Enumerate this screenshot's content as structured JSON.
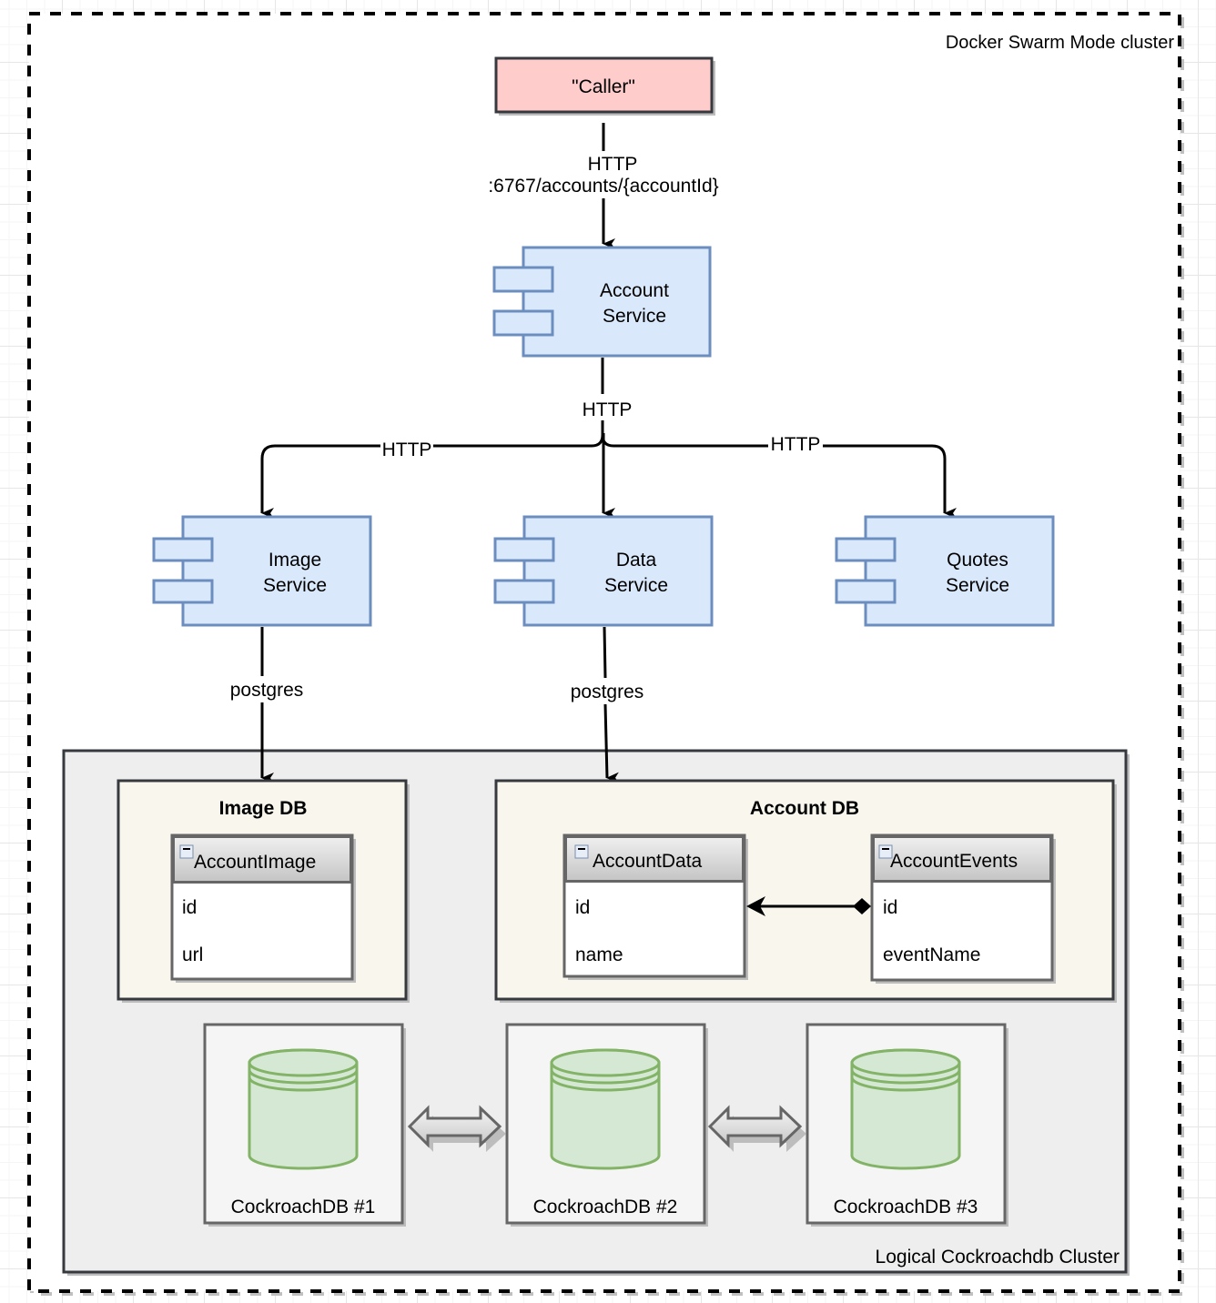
{
  "swarm_cluster": {
    "label": "Docker Swarm Mode cluster"
  },
  "caller": {
    "label": "\"Caller\"",
    "fill": "#ffcccc"
  },
  "edges": {
    "caller_to_account": {
      "line1": "HTTP",
      "line2": ":6767/accounts/{accountId}"
    },
    "account_fanout": "HTTP",
    "to_image": "HTTP",
    "to_quotes": "HTTP",
    "image_to_db": "postgres",
    "data_to_db": "postgres"
  },
  "services": {
    "account": {
      "line1": "Account",
      "line2": "Service"
    },
    "image": {
      "line1": "Image",
      "line2": "Service"
    },
    "data": {
      "line1": "Data",
      "line2": "Service"
    },
    "quotes": {
      "line1": "Quotes",
      "line2": "Service"
    }
  },
  "cockroach_cluster": {
    "label": "Logical Cockroachdb Cluster"
  },
  "image_db": {
    "title": "Image DB",
    "table": {
      "name": "AccountImage",
      "fields": [
        "id",
        "url"
      ]
    }
  },
  "account_db": {
    "title": "Account DB",
    "tables": [
      {
        "name": "AccountData",
        "fields": [
          "id",
          "name"
        ]
      },
      {
        "name": "AccountEvents",
        "fields": [
          "id",
          "eventName"
        ]
      }
    ]
  },
  "nodes": [
    "CockroachDB #1",
    "CockroachDB #2",
    "CockroachDB #3"
  ],
  "colors": {
    "service_fill": "#dae8fc",
    "service_stroke": "#6c8ebf",
    "db_fill": "#d5e8d4",
    "db_stroke": "#82b366",
    "cluster_fill": "#eeeeee",
    "dbgroup_fill": "#f9f7ed"
  }
}
